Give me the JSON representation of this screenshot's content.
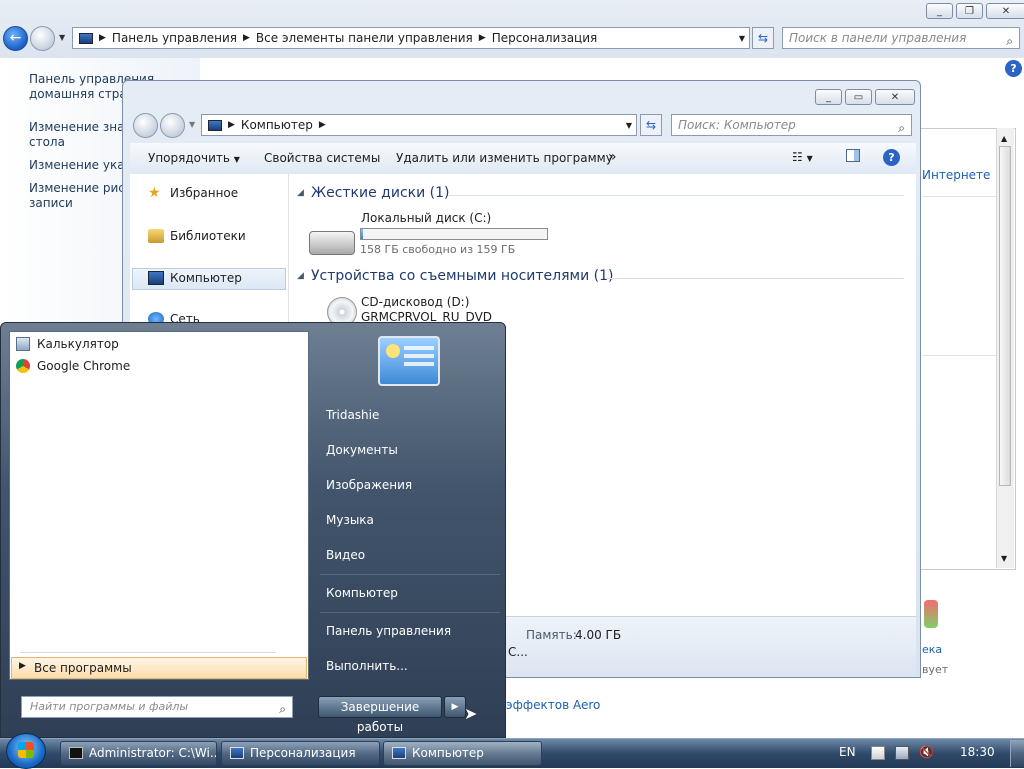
{
  "control_panel": {
    "breadcrumb": [
      "Панель управления",
      "Все элементы панели управления",
      "Персонализация"
    ],
    "search_placeholder": "Поиск в панели управления",
    "left_links": [
      [
        "Панель управления",
        "домашняя стран"
      ],
      [
        "Изменение значк",
        "стола"
      ],
      [
        "Изменение указа"
      ],
      [
        "Изменение рисун",
        "записи"
      ]
    ],
    "partial_texts": {
      "internet": "Интернете",
      "aero": "эффектов Aero",
      "eka": "ека",
      "vuet": "вует",
      "memory_label": "Память:",
      "memory_value": "4.00 ГБ",
      "cpu_fragment": "С..."
    }
  },
  "explorer": {
    "breadcrumb": [
      "Компьютер"
    ],
    "search_placeholder": "Поиск: Компьютер",
    "toolbar": {
      "organize": "Упорядочить",
      "system_properties": "Свойства системы",
      "uninstall": "Удалить или изменить программу",
      "more": "»"
    },
    "nav": {
      "favorites": "Избранное",
      "libraries": "Библиотеки",
      "computer": "Компьютер",
      "network": "Сеть"
    },
    "groups": {
      "hard_disks": "Жесткие диски (1)",
      "removable": "Устройства со съемными носителями (1)"
    },
    "drive_c": {
      "name": "Локальный диск (C:)",
      "free": "158 ГБ свободно из 159 ГБ",
      "used_fraction": 0.01
    },
    "drive_d": {
      "name": "CD-дисковод (D:)",
      "label": "GRMCPRVOL_RU_DVD"
    }
  },
  "start_menu": {
    "programs": [
      "Калькулятор",
      "Google Chrome"
    ],
    "all_programs": "Все программы",
    "search_placeholder": "Найти программы и файлы",
    "right_items": [
      "Tridashie",
      "Документы",
      "Изображения",
      "Музыка",
      "Видео",
      "Компьютер",
      "Панель управления",
      "Выполнить..."
    ],
    "shutdown": "Завершение работы"
  },
  "taskbar": {
    "buttons": [
      "Administrator: C:\\Wi...",
      "Персонализация",
      "Компьютер"
    ],
    "language": "EN",
    "time": "18:30"
  },
  "colors": {
    "accent": "#2b64c4",
    "taskbar": "#2f4a6a",
    "all_programs_highlight": "#fddcaa"
  }
}
